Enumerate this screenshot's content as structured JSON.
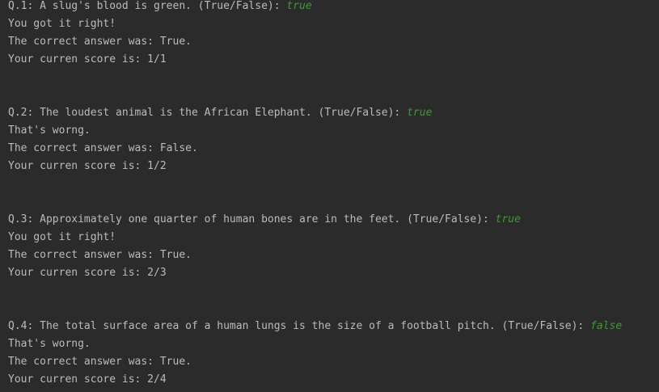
{
  "console": {
    "blocks": [
      {
        "question": "Q.1: A slug's blood is green. (True/False): ",
        "input": "true",
        "result": "You got it right!",
        "correct": "The correct answer was: True.",
        "score": "Your curren score is: 1/1"
      },
      {
        "question": "Q.2: The loudest animal is the African Elephant. (True/False): ",
        "input": "true",
        "result": "That's worng.",
        "correct": "The correct answer was: False.",
        "score": "Your curren score is: 1/2"
      },
      {
        "question": "Q.3: Approximately one quarter of human bones are in the feet. (True/False): ",
        "input": "true",
        "result": "You got it right!",
        "correct": "The correct answer was: True.",
        "score": "Your curren score is: 2/3"
      },
      {
        "question": "Q.4: The total surface area of a human lungs is the size of a football pitch. (True/False): ",
        "input": "false",
        "result": "That's worng.",
        "correct": "The correct answer was: True.",
        "score": "Your curren score is: 2/4"
      }
    ],
    "colors": {
      "background": "#2b2b2b",
      "text": "#bbbbbb",
      "user_input": "#3a9c2e"
    }
  }
}
